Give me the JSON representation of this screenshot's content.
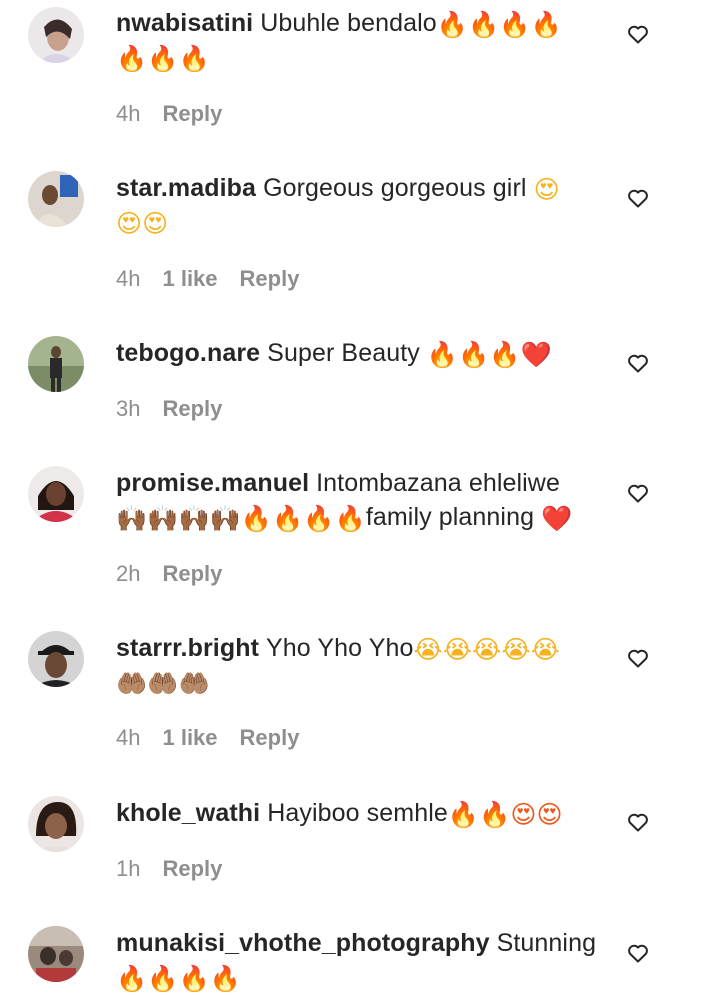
{
  "comments": [
    {
      "username": "nwabisatini",
      "text": "Ubuhle bendalo",
      "emojis_line1": "🔥🔥🔥🔥",
      "emojis_line2": "🔥🔥🔥",
      "time": "4h",
      "likes": "",
      "reply": "Reply",
      "avatar_colors": [
        "#e8e2e6",
        "#c9a38e",
        "#3a2a2a"
      ]
    },
    {
      "username": "star.madiba",
      "text": "Gorgeous gorgeous girl",
      "emojis_line1": "😍",
      "emojis_line2": "😍😍",
      "time": "4h",
      "likes": "1 like",
      "reply": "Reply",
      "avatar_colors": [
        "#d9d4cf",
        "#3566b5",
        "#6b4a33"
      ]
    },
    {
      "username": "tebogo.nare",
      "text": "Super Beauty",
      "emojis_line1": "🔥🔥🔥❤️",
      "emojis_line2": "",
      "time": "3h",
      "likes": "",
      "reply": "Reply",
      "avatar_colors": [
        "#9fb08a",
        "#2e2e2e",
        "#6f5b47"
      ]
    },
    {
      "username": "promise.manuel",
      "text": "Intombazana ehleliwe",
      "emojis_line1": "",
      "emojis_line2": "🙌🏾🙌🏾🙌🏾🙌🏾🔥🔥🔥🔥",
      "text2": "family planning",
      "emojis_line3": "❤️",
      "time": "2h",
      "likes": "",
      "reply": "Reply",
      "avatar_colors": [
        "#2b1c18",
        "#d1314a",
        "#5e3b2c"
      ]
    },
    {
      "username": "starrr.bright",
      "text": "Yho Yho Yho",
      "emojis_line1": "😭😭😭😭😭",
      "emojis_line2": "🤲🏽🤲🏽🤲🏽",
      "time": "4h",
      "likes": "1 like",
      "reply": "Reply",
      "avatar_colors": [
        "#cfcfcf",
        "#1b1b1b",
        "#6a4a36"
      ]
    },
    {
      "username": "khole_wathi",
      "text": "Hayiboo semhle",
      "emojis_line1": "🔥🔥😍😍",
      "emojis_line2": "",
      "time": "1h",
      "likes": "",
      "reply": "Reply",
      "avatar_colors": [
        "#e9e4e2",
        "#2a1a14",
        "#8a5e45"
      ]
    },
    {
      "username": "munakisi_vhothe_photography",
      "text": "Stunning",
      "emojis_line1": "",
      "emojis_line2": "🔥🔥🔥🔥",
      "time": "",
      "likes": "",
      "reply": "",
      "avatar_colors": [
        "#9a8a7e",
        "#3b2f2a",
        "#b23a3a"
      ]
    }
  ],
  "colors": {
    "username": "#262626",
    "meta": "#8e8e8e",
    "heart_outline": "#262626"
  },
  "icons": {
    "like": "heart-outline-icon"
  }
}
